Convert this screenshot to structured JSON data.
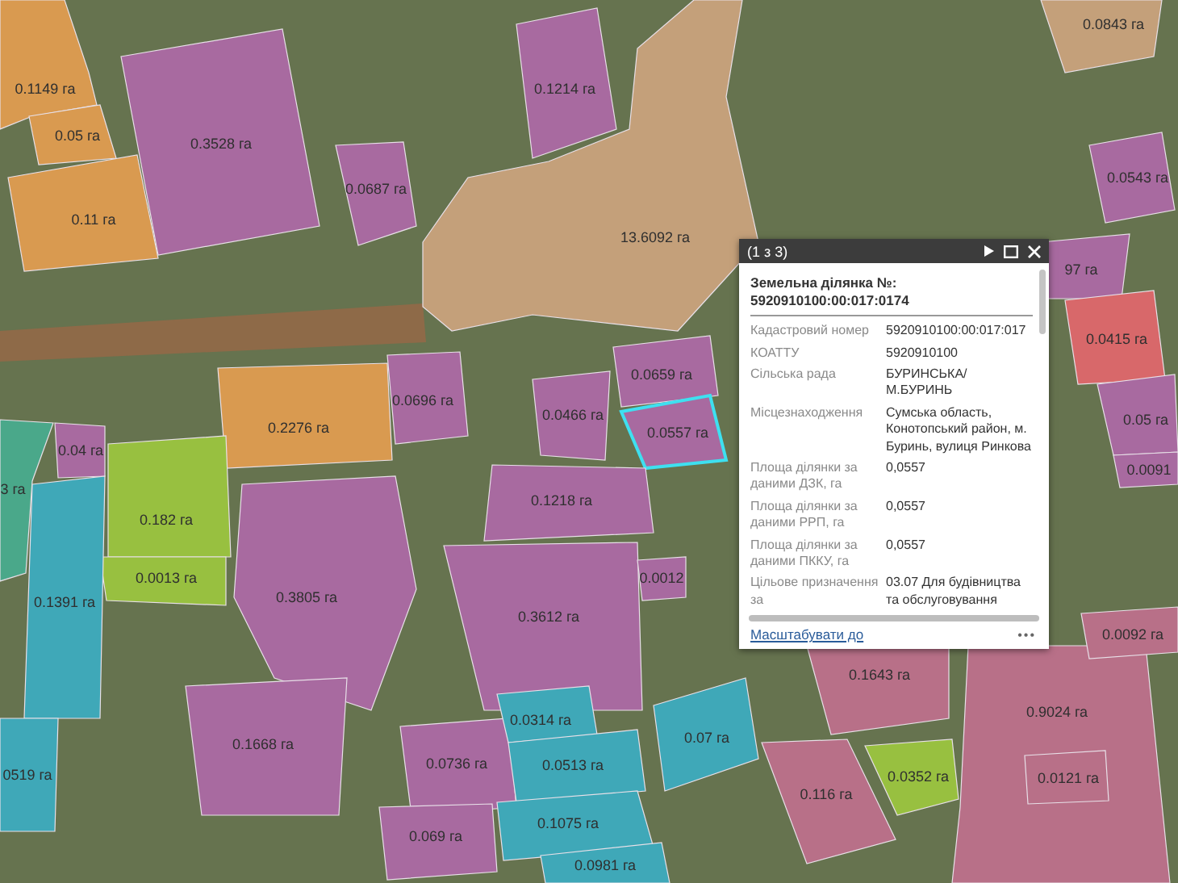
{
  "map": {
    "parcels": [
      {
        "label": "0.1149 га",
        "color": "#d99a50",
        "selected": false
      },
      {
        "label": "0.05 га",
        "color": "#d99a50",
        "selected": false
      },
      {
        "label": "0.11 га",
        "color": "#d99a50",
        "selected": false
      },
      {
        "label": "0.3528 га",
        "color": "#a86aa0",
        "selected": false
      },
      {
        "label": "0.0687 га",
        "color": "#a86aa0",
        "selected": false
      },
      {
        "label": "0.1214 га",
        "color": "#a86aa0",
        "selected": false
      },
      {
        "label": "13.6092 га",
        "color": "#c4a07a",
        "selected": false
      },
      {
        "label": "0.0843 га",
        "color": "#c4a07a",
        "selected": false
      },
      {
        "label": "0.0543 га",
        "color": "#a86aa0",
        "selected": false
      },
      {
        "label": "0.2276 га",
        "color": "#d99a50",
        "selected": false
      },
      {
        "label": "0.0696 га",
        "color": "#a86aa0",
        "selected": false
      },
      {
        "label": "0.0466 га",
        "color": "#a86aa0",
        "selected": false
      },
      {
        "label": "0.0659 га",
        "color": "#a86aa0",
        "selected": false
      },
      {
        "label": "0.0557 га",
        "color": "#a86aa0",
        "selected": true
      },
      {
        "label": "97 га",
        "color": "#a86aa0",
        "selected": false
      },
      {
        "label": "0.0415 га",
        "color": "#d8686a",
        "selected": false
      },
      {
        "label": "0.05 га",
        "color": "#a86aa0",
        "selected": false
      },
      {
        "label": "0.0091",
        "color": "#a86aa0",
        "selected": false
      },
      {
        "label": "0.04 га",
        "color": "#a86aa0",
        "selected": false
      },
      {
        "label": "3 га",
        "color": "#4aa88a",
        "selected": false
      },
      {
        "label": "0.182 га",
        "color": "#98c040",
        "selected": false
      },
      {
        "label": "0.0013 га",
        "color": "#98c040",
        "selected": false
      },
      {
        "label": "0.1391 га",
        "color": "#3fa8b8",
        "selected": false
      },
      {
        "label": "0.3805 га",
        "color": "#a86aa0",
        "selected": false
      },
      {
        "label": "0.1218 га",
        "color": "#a86aa0",
        "selected": false
      },
      {
        "label": "0.3612 га",
        "color": "#a86aa0",
        "selected": false
      },
      {
        "label": "0.0012",
        "color": "#a86aa0",
        "selected": false
      },
      {
        "label": "0.1668 га",
        "color": "#a86aa0",
        "selected": false
      },
      {
        "label": "0519 га",
        "color": "#3fa8b8",
        "selected": false
      },
      {
        "label": "0.0736 га",
        "color": "#a86aa0",
        "selected": false
      },
      {
        "label": "0.0314 га",
        "color": "#3fa8b8",
        "selected": false
      },
      {
        "label": "0.0513 га",
        "color": "#3fa8b8",
        "selected": false
      },
      {
        "label": "0.069 га",
        "color": "#a86aa0",
        "selected": false
      },
      {
        "label": "0.1075 га",
        "color": "#3fa8b8",
        "selected": false
      },
      {
        "label": "0.0981 га",
        "color": "#3fa8b8",
        "selected": false
      },
      {
        "label": "0.07 га",
        "color": "#3fa8b8",
        "selected": false
      },
      {
        "label": "0.116 га",
        "color": "#b87088",
        "selected": false
      },
      {
        "label": "0.1643 га",
        "color": "#b87088",
        "selected": false
      },
      {
        "label": "0.0352 га",
        "color": "#98c040",
        "selected": false
      },
      {
        "label": "0.9024 га",
        "color": "#b87088",
        "selected": false
      },
      {
        "label": "0.0121 га",
        "color": "#b87088",
        "selected": false
      },
      {
        "label": "0.0092 га",
        "color": "#b87088",
        "selected": false
      }
    ]
  },
  "popup": {
    "pager": "(1 з 3)",
    "title_label": "Земельна ділянка №:",
    "title_value": "5920910100:00:017:0174",
    "fields": [
      {
        "label": "Кадастровий номер",
        "value": "5920910100:00:017:017"
      },
      {
        "label": "КОАТТУ",
        "value": "5920910100"
      },
      {
        "label": "Сільська рада",
        "value": "БУРИНСЬКА/М.БУРИНЬ"
      },
      {
        "label": "Місцезнаходження",
        "value": "Сумська область, Конотопський район, м. Буринь, вулиця Ринкова"
      },
      {
        "label": "Площа ділянки за даними ДЗК, га",
        "value": "0,0557"
      },
      {
        "label": "Площа ділянки за даними РРП, га",
        "value": "0,0557"
      },
      {
        "label": "Площа ділянки за даними ПККУ, га",
        "value": "0,0557"
      },
      {
        "label": "Цільове призначення за",
        "value": "03.07 Для будівництва та обслуговування"
      }
    ],
    "zoom_link": "Масштабувати до",
    "more": "•••"
  }
}
